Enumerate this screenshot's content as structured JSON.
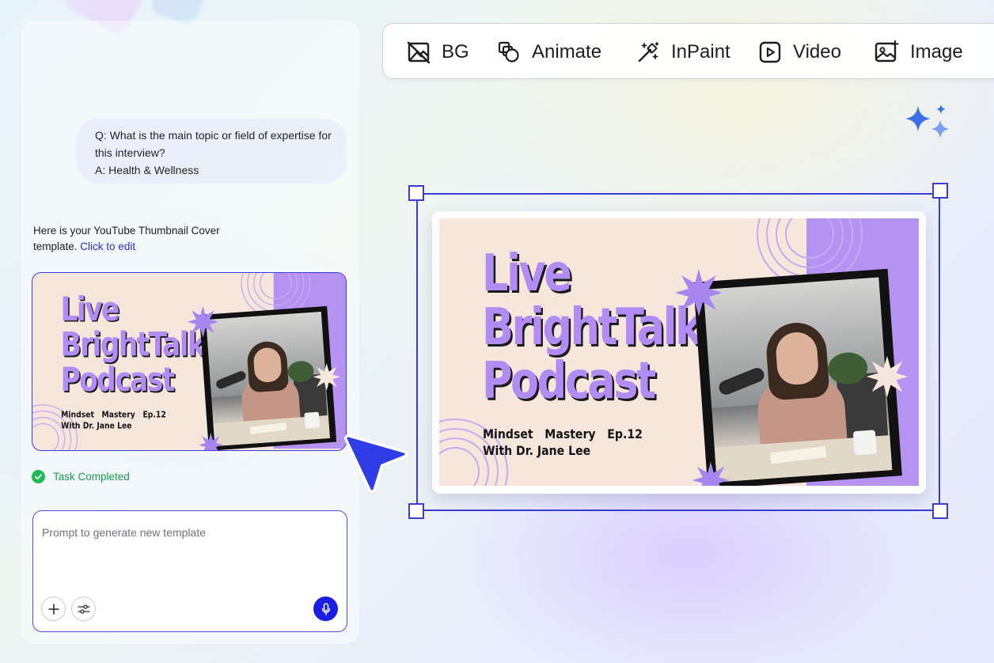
{
  "toolbar": {
    "tools": [
      {
        "label": "BG",
        "icon": "remove-bg-icon"
      },
      {
        "label": "Animate",
        "icon": "animate-icon"
      },
      {
        "label": "InPaint",
        "icon": "magic-wand-icon"
      },
      {
        "label": "Video",
        "icon": "video-icon"
      },
      {
        "label": "Image",
        "icon": "image-icon"
      }
    ]
  },
  "chat": {
    "question": "Q: What is the main topic or field of expertise for this interview?",
    "answer": "A: Health & Wellness",
    "reply_text": "Here is your YouTube Thumbnail Cover template.",
    "reply_link": "Click to edit",
    "status": "Task Completed"
  },
  "thumbnail": {
    "title_lines": [
      "Live",
      "BrightTalk",
      "Podcast"
    ],
    "subtitle_line1": "Mindset   Mastery   Ep.12",
    "subtitle_line2": "With Dr. Jane Lee"
  },
  "prompt": {
    "placeholder": "Prompt to generate new template"
  },
  "colors": {
    "accent": "#3c3cd2",
    "thumbnail_purple": "#b08cf3",
    "thumbnail_bg": "#f6e6dc",
    "success": "#1db954",
    "mic_button": "#1a1ee4"
  }
}
